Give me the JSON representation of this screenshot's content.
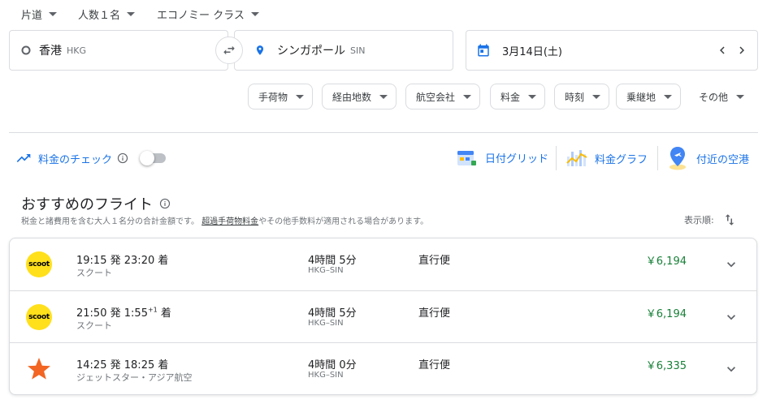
{
  "top_options": {
    "trip_type": "片道",
    "passengers": "人数１名",
    "cabin": "エコノミー クラス"
  },
  "search": {
    "origin_name": "香港",
    "origin_code": "HKG",
    "destination_name": "シンガポール",
    "destination_code": "SIN",
    "date": "3月14日(土)"
  },
  "filters": [
    "手荷物",
    "経由地数",
    "航空会社",
    "料金",
    "時刻",
    "乗継地",
    "その他"
  ],
  "tools": {
    "price_tracking": "料金のチェック",
    "date_grid": "日付グリッド",
    "price_graph": "料金グラフ",
    "nearby_airports": "付近の空港"
  },
  "section": {
    "title": "おすすめのフライト",
    "note_before": "税金と諸費用を含む大人１名分の合計金額です。",
    "note_link": "超過手荷物料金",
    "note_after": "やその他手数料が適用される場合があります。",
    "sort_label": "表示順:"
  },
  "flights": [
    {
      "logo": "scoot",
      "depart": "19:15",
      "depart_suffix": "発",
      "arrive": "23:20",
      "arrive_suffix": "着",
      "day_offset": "",
      "airline": "スクート",
      "duration": "4時間 5分",
      "route": "HKG–SIN",
      "stops": "直行便",
      "price": "￥6,194"
    },
    {
      "logo": "scoot",
      "depart": "21:50",
      "depart_suffix": "発",
      "arrive": "1:55",
      "arrive_suffix": "着",
      "day_offset": "+1",
      "airline": "スクート",
      "duration": "4時間 5分",
      "route": "HKG–SIN",
      "stops": "直行便",
      "price": "￥6,194"
    },
    {
      "logo": "star-icon",
      "depart": "14:25",
      "depart_suffix": "発",
      "arrive": "18:25",
      "arrive_suffix": "着",
      "day_offset": "",
      "airline": "ジェットスター・アジア航空",
      "duration": "4時間 0分",
      "route": "HKG–SIN",
      "stops": "直行便",
      "price": "￥6,335"
    }
  ],
  "colors": {
    "accent": "#1a73e8",
    "price": "#188038",
    "scoot_yellow": "#ffe01b",
    "jetstar_orange": "#f26522"
  }
}
